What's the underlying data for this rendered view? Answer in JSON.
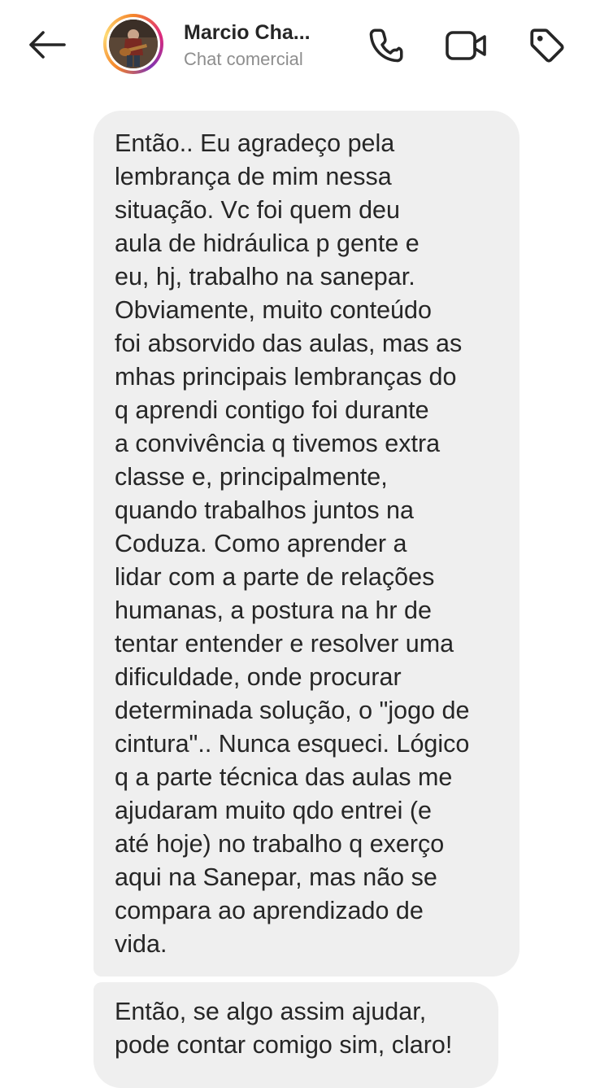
{
  "header": {
    "contact_name": "Marcio Cha...",
    "contact_subtitle": "Chat comercial",
    "icons": [
      "back-arrow-icon",
      "phone-icon",
      "video-camera-icon",
      "tag-icon"
    ],
    "accent_colors": {
      "ring_start": "#f58529",
      "ring_mid": "#dd2a7b",
      "ring_end": "#8134af"
    }
  },
  "messages": [
    {
      "lines": [
        "Então.. Eu agradeço pela",
        "lembrança de mim nessa",
        "situação. Vc foi quem deu",
        "aula de hidráulica p gente e",
        "eu, hj, trabalho na sanepar.",
        "Obviamente, muito conteúdo",
        "foi absorvido das aulas, mas as",
        "mhas principais lembranças do",
        "q aprendi contigo foi durante",
        "a convivência q tivemos extra",
        "classe e, principalmente,",
        "quando trabalhos juntos na",
        "Coduza. Como aprender a",
        "lidar com a parte de relações",
        "humanas, a postura na hr de",
        "tentar entender e resolver uma",
        "dificuldade, onde procurar",
        "determinada solução, o \"jogo de",
        "cintura\".. Nunca esqueci. Lógico",
        "q a parte técnica das aulas me",
        "ajudaram muito qdo entrei (e",
        "até hoje) no trabalho q exerço",
        "aqui na Sanepar, mas não se",
        "compara ao aprendizado de",
        "vida."
      ]
    },
    {
      "lines": [
        "Então, se algo assim ajudar,",
        "pode contar comigo sim, claro!"
      ]
    }
  ],
  "colors": {
    "bubble_background": "#efefef",
    "text": "#262626",
    "subtitle": "#8e8e8e"
  }
}
